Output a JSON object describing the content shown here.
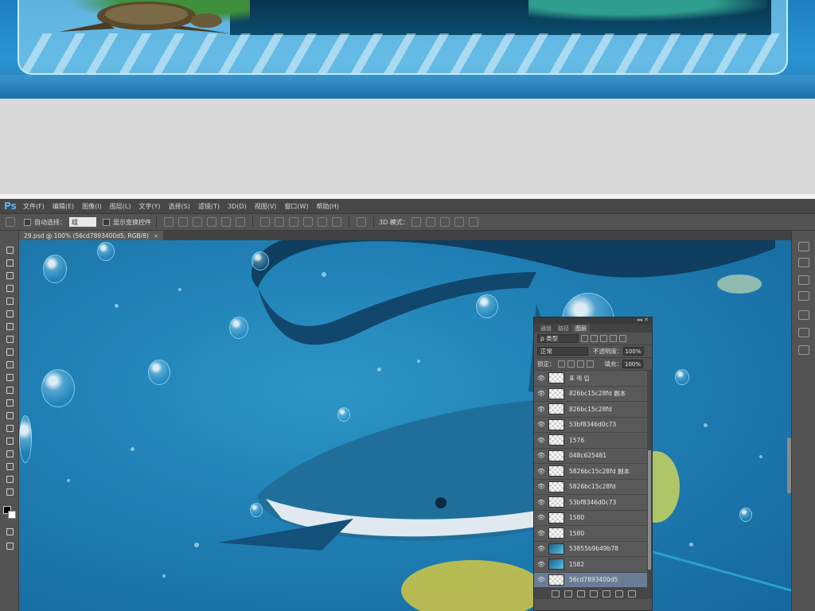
{
  "app": {
    "logo": "Ps",
    "menus": [
      "文件(F)",
      "编辑(E)",
      "图像(I)",
      "图层(L)",
      "文字(Y)",
      "选择(S)",
      "滤镜(T)",
      "3D(D)",
      "视图(V)",
      "窗口(W)",
      "帮助(H)"
    ]
  },
  "options_bar": {
    "auto_select_label": "自动选择：",
    "auto_select_value": "组",
    "show_transform_label": "显示变换控件",
    "mode_3d_label": "3D 模式："
  },
  "document_tab": {
    "title": "29.psd @ 100% (56cd7893400d5, RGB/8)",
    "close": "×"
  },
  "layers_panel": {
    "tabs": [
      "通道",
      "路径",
      "图层"
    ],
    "active_tab": "图层",
    "filter_label": "ρ 类型",
    "blend_mode": "正常",
    "opacity_label": "不透明度：",
    "opacity_value": "100%",
    "lock_label": "锁定：",
    "fill_label": "填充：",
    "fill_value": "100%",
    "layers": [
      {
        "name": "표 레 입",
        "thumb": "checker",
        "selected": false
      },
      {
        "name": "826bc15c28fd 副本",
        "thumb": "checker",
        "selected": false
      },
      {
        "name": "826bc15c28fd",
        "thumb": "checker",
        "selected": false
      },
      {
        "name": "53bf8346d0c73",
        "thumb": "checker",
        "selected": false
      },
      {
        "name": "1576",
        "thumb": "checker",
        "selected": false
      },
      {
        "name": "048c625481",
        "thumb": "checker",
        "selected": false
      },
      {
        "name": "5826bc15c28fd 副本",
        "thumb": "checker",
        "selected": false
      },
      {
        "name": "5826bc15c28fd",
        "thumb": "checker",
        "selected": false
      },
      {
        "name": "53bf8346d0c73",
        "thumb": "checker",
        "selected": false
      },
      {
        "name": "1580",
        "thumb": "checker",
        "selected": false
      },
      {
        "name": "1580",
        "thumb": "checker",
        "selected": false
      },
      {
        "name": "53855b9b49b78",
        "thumb": "image",
        "selected": false
      },
      {
        "name": "1582",
        "thumb": "image",
        "selected": false
      },
      {
        "name": "56cd7893400d5",
        "thumb": "checker",
        "selected": true
      }
    ],
    "footer_icons": [
      "link-icon",
      "fx-icon",
      "mask-icon",
      "adjustment-icon",
      "folder-icon",
      "new-layer-icon",
      "trash-icon"
    ]
  },
  "colors": {
    "ps_dark": "#535353",
    "menubar": "#474747",
    "accent_ps": "#5ab4f0",
    "ocean": "#1f7fb4"
  }
}
